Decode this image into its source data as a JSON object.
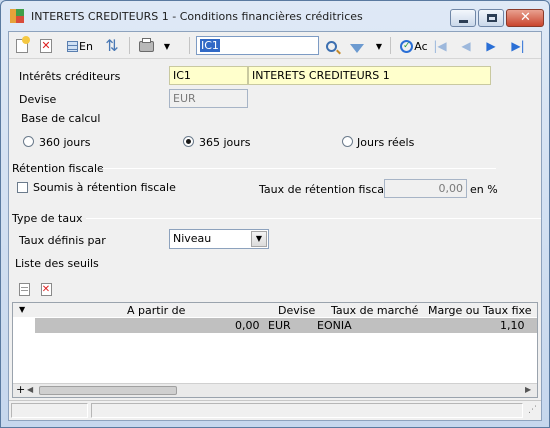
{
  "window": {
    "title": "INTERETS CREDITEURS 1 -  Conditions financières créditrices"
  },
  "toolbar": {
    "translate_label": "En",
    "search_value": "IC1",
    "filter_label": "Ac"
  },
  "form": {
    "interets_label": "Intérêts créditeurs",
    "code_value": "IC1",
    "libelle_value": "INTERETS CREDITEURS 1",
    "devise_label": "Devise",
    "devise_value": "EUR",
    "base_calcul_label": "Base de calcul",
    "radio_360": "360 jours",
    "radio_365": "365 jours",
    "radio_reels": "Jours réels",
    "selected_base": "365 jours",
    "retention_section": "Rétention fiscale",
    "soumis_label": "Soumis à rétention fiscale",
    "soumis_checked": false,
    "taux_retention_label": "Taux de rétention fiscale",
    "taux_retention_value": "0,00",
    "taux_retention_unit": "en %",
    "type_taux_section": "Type de taux",
    "taux_definis_label": "Taux définis par",
    "taux_definis_value": "Niveau",
    "liste_seuils_label": "Liste des seuils"
  },
  "grid": {
    "columns": [
      "A partir de",
      "Devise",
      "Taux de marché",
      "Marge ou Taux fixe"
    ],
    "rows": [
      {
        "a_partir_de": "0,00",
        "devise": "EUR",
        "taux_marche": "EONIA",
        "marge": "1,10"
      }
    ],
    "add_row_label": "+"
  },
  "colors": {
    "highlight_field": "#ffffcc",
    "selected_row": "#c0c0c0",
    "accent_blue": "#2a6fd6"
  }
}
